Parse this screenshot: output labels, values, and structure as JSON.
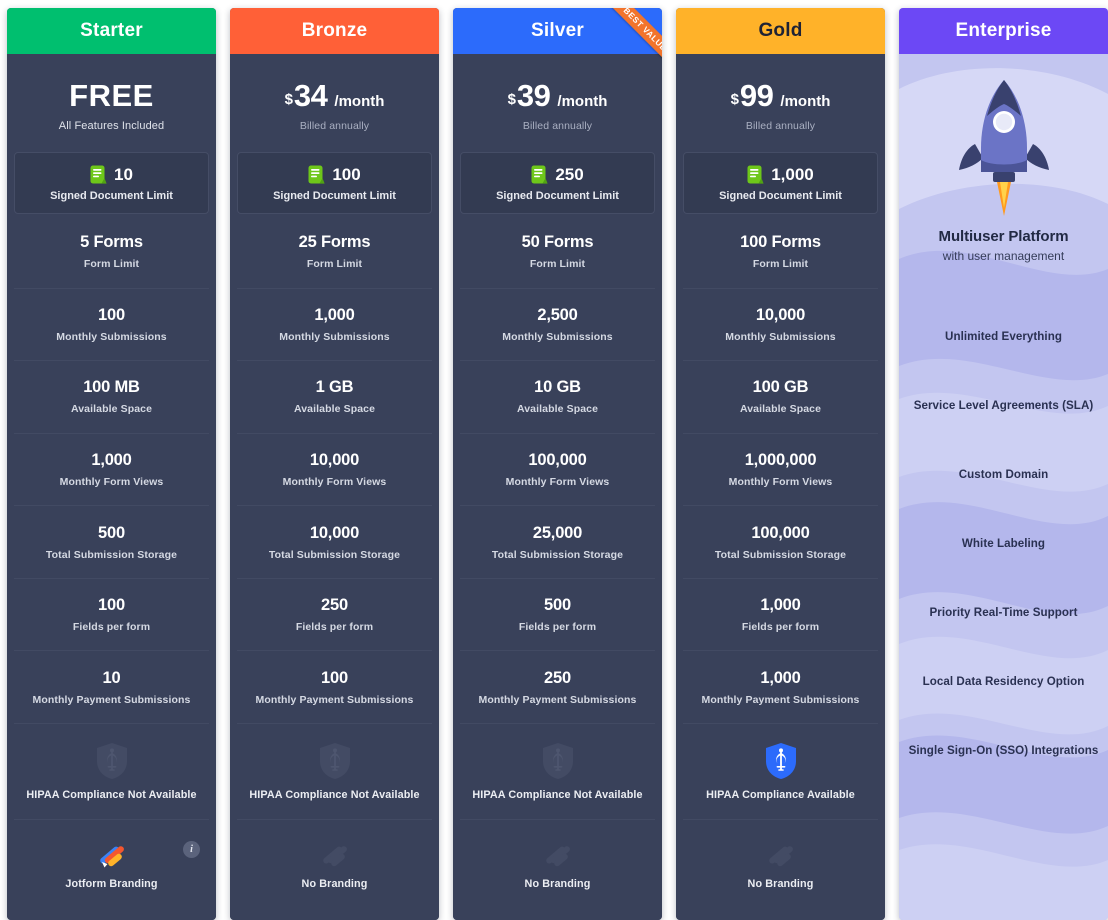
{
  "colors": {
    "starter": "#00bf6f",
    "bronze": "#ff6037",
    "silver": "#2c6bfb",
    "gold": "#ffb229",
    "enterprise": "#6c48f5",
    "panel": "#39415a",
    "panel_highlight": "#333b52",
    "ribbon": "#f2742c",
    "enterprise_body": "#c3c6f0"
  },
  "ribbon": {
    "label": "BEST VALUE"
  },
  "info_badge": {
    "label": "i"
  },
  "plans": [
    {
      "name": "Starter",
      "header_bg": "#00bf6f",
      "header_fg": "#ffffff",
      "price": {
        "currency": "",
        "amount": "FREE",
        "period": "",
        "sub": "All Features Included",
        "is_free": true
      },
      "signed": {
        "value": "10",
        "label": "Signed Document Limit"
      },
      "features": [
        {
          "value": "5 Forms",
          "label": "Form Limit"
        },
        {
          "value": "100",
          "label": "Monthly Submissions"
        },
        {
          "value": "100 MB",
          "label": "Available Space"
        },
        {
          "value": "1,000",
          "label": "Monthly Form Views"
        },
        {
          "value": "500",
          "label": "Total Submission Storage"
        },
        {
          "value": "100",
          "label": "Fields per form"
        },
        {
          "value": "10",
          "label": "Monthly Payment Submissions"
        }
      ],
      "hipaa": {
        "label": "HIPAA Compliance Not Available",
        "available": false
      },
      "branding": {
        "label": "Jotform Branding",
        "jotform": true,
        "has_info": true
      }
    },
    {
      "name": "Bronze",
      "header_bg": "#ff6037",
      "header_fg": "#ffffff",
      "price": {
        "currency": "$",
        "amount": "34",
        "period": "/month",
        "sub": "Billed annually",
        "is_free": false
      },
      "signed": {
        "value": "100",
        "label": "Signed Document Limit"
      },
      "features": [
        {
          "value": "25 Forms",
          "label": "Form Limit"
        },
        {
          "value": "1,000",
          "label": "Monthly Submissions"
        },
        {
          "value": "1 GB",
          "label": "Available Space"
        },
        {
          "value": "10,000",
          "label": "Monthly Form Views"
        },
        {
          "value": "10,000",
          "label": "Total Submission Storage"
        },
        {
          "value": "250",
          "label": "Fields per form"
        },
        {
          "value": "100",
          "label": "Monthly Payment Submissions"
        }
      ],
      "hipaa": {
        "label": "HIPAA Compliance Not Available",
        "available": false
      },
      "branding": {
        "label": "No Branding",
        "jotform": false,
        "has_info": false
      }
    },
    {
      "name": "Silver",
      "header_bg": "#2c6bfb",
      "header_fg": "#ffffff",
      "badge": "BEST VALUE",
      "price": {
        "currency": "$",
        "amount": "39",
        "period": "/month",
        "sub": "Billed annually",
        "is_free": false
      },
      "signed": {
        "value": "250",
        "label": "Signed Document Limit"
      },
      "features": [
        {
          "value": "50 Forms",
          "label": "Form Limit"
        },
        {
          "value": "2,500",
          "label": "Monthly Submissions"
        },
        {
          "value": "10 GB",
          "label": "Available Space"
        },
        {
          "value": "100,000",
          "label": "Monthly Form Views"
        },
        {
          "value": "25,000",
          "label": "Total Submission Storage"
        },
        {
          "value": "500",
          "label": "Fields per form"
        },
        {
          "value": "250",
          "label": "Monthly Payment Submissions"
        }
      ],
      "hipaa": {
        "label": "HIPAA Compliance Not Available",
        "available": false
      },
      "branding": {
        "label": "No Branding",
        "jotform": false,
        "has_info": false
      }
    },
    {
      "name": "Gold",
      "header_bg": "#ffb229",
      "header_fg": "#1e2235",
      "price": {
        "currency": "$",
        "amount": "99",
        "period": "/month",
        "sub": "Billed annually",
        "is_free": false
      },
      "signed": {
        "value": "1,000",
        "label": "Signed Document Limit"
      },
      "features": [
        {
          "value": "100 Forms",
          "label": "Form Limit"
        },
        {
          "value": "10,000",
          "label": "Monthly Submissions"
        },
        {
          "value": "100 GB",
          "label": "Available Space"
        },
        {
          "value": "1,000,000",
          "label": "Monthly Form Views"
        },
        {
          "value": "100,000",
          "label": "Total Submission Storage"
        },
        {
          "value": "1,000",
          "label": "Fields per form"
        },
        {
          "value": "1,000",
          "label": "Monthly Payment Submissions"
        }
      ],
      "hipaa": {
        "label": "HIPAA Compliance Available",
        "available": true
      },
      "branding": {
        "label": "No Branding",
        "jotform": false,
        "has_info": false
      }
    }
  ],
  "enterprise": {
    "name": "Enterprise",
    "header_bg": "#6c48f5",
    "hero_title": "Multiuser Platform",
    "hero_sub": "with user management",
    "features": [
      "Unlimited Everything",
      "Service Level Agreements (SLA)",
      "Custom Domain",
      "White Labeling",
      "Priority Real-Time Support",
      "Local Data Residency Option",
      "Single Sign-On (SSO) Integrations"
    ]
  }
}
